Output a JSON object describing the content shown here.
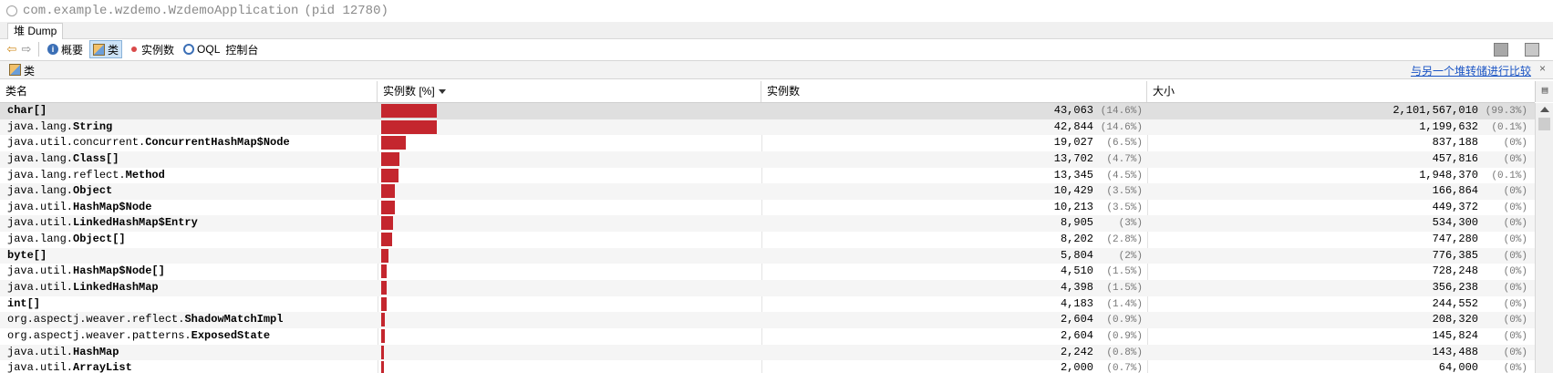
{
  "window": {
    "title": "com.example.wzdemo.WzdemoApplication",
    "pid": "(pid 12780)"
  },
  "tab": {
    "label": "堆 Dump"
  },
  "toolbar": {
    "summary": "概要",
    "classes": "类",
    "instances": "实例数",
    "oql": "OQL",
    "console": "控制台"
  },
  "panel": {
    "title": "类",
    "compare_link": "与另一个堆转储进行比较",
    "close": "×"
  },
  "table": {
    "headers": {
      "name": "类名",
      "instances_pct": "实例数 [%]",
      "instances": "实例数",
      "size": "大小"
    },
    "sort": {
      "column": "instances_pct",
      "direction": "descending"
    },
    "rows": [
      {
        "pkg": "",
        "cls": "char[]",
        "bar_pct": 14.6,
        "count": "43,063",
        "count_pct": "(14.6%)",
        "size": "2,101,567,010",
        "size_pct": "(99.3%)"
      },
      {
        "pkg": "java.lang.",
        "cls": "String",
        "bar_pct": 14.6,
        "count": "42,844",
        "count_pct": "(14.6%)",
        "size": "1,199,632",
        "size_pct": "(0.1%)"
      },
      {
        "pkg": "java.util.concurrent.",
        "cls": "ConcurrentHashMap$Node",
        "bar_pct": 6.5,
        "count": "19,027",
        "count_pct": "(6.5%)",
        "size": "837,188",
        "size_pct": "(0%)"
      },
      {
        "pkg": "java.lang.",
        "cls": "Class[]",
        "bar_pct": 4.7,
        "count": "13,702",
        "count_pct": "(4.7%)",
        "size": "457,816",
        "size_pct": "(0%)"
      },
      {
        "pkg": "java.lang.reflect.",
        "cls": "Method",
        "bar_pct": 4.5,
        "count": "13,345",
        "count_pct": "(4.5%)",
        "size": "1,948,370",
        "size_pct": "(0.1%)"
      },
      {
        "pkg": "java.lang.",
        "cls": "Object",
        "bar_pct": 3.5,
        "count": "10,429",
        "count_pct": "(3.5%)",
        "size": "166,864",
        "size_pct": "(0%)"
      },
      {
        "pkg": "java.util.",
        "cls": "HashMap$Node",
        "bar_pct": 3.5,
        "count": "10,213",
        "count_pct": "(3.5%)",
        "size": "449,372",
        "size_pct": "(0%)"
      },
      {
        "pkg": "java.util.",
        "cls": "LinkedHashMap$Entry",
        "bar_pct": 3.0,
        "count": "8,905",
        "count_pct": "(3%)",
        "size": "534,300",
        "size_pct": "(0%)"
      },
      {
        "pkg": "java.lang.",
        "cls": "Object[]",
        "bar_pct": 2.8,
        "count": "8,202",
        "count_pct": "(2.8%)",
        "size": "747,280",
        "size_pct": "(0%)"
      },
      {
        "pkg": "",
        "cls": "byte[]",
        "bar_pct": 2.0,
        "count": "5,804",
        "count_pct": "(2%)",
        "size": "776,385",
        "size_pct": "(0%)"
      },
      {
        "pkg": "java.util.",
        "cls": "HashMap$Node[]",
        "bar_pct": 1.5,
        "count": "4,510",
        "count_pct": "(1.5%)",
        "size": "728,248",
        "size_pct": "(0%)"
      },
      {
        "pkg": "java.util.",
        "cls": "LinkedHashMap",
        "bar_pct": 1.5,
        "count": "4,398",
        "count_pct": "(1.5%)",
        "size": "356,238",
        "size_pct": "(0%)"
      },
      {
        "pkg": "",
        "cls": "int[]",
        "bar_pct": 1.4,
        "count": "4,183",
        "count_pct": "(1.4%)",
        "size": "244,552",
        "size_pct": "(0%)"
      },
      {
        "pkg": "org.aspectj.weaver.reflect.",
        "cls": "ShadowMatchImpl",
        "bar_pct": 0.9,
        "count": "2,604",
        "count_pct": "(0.9%)",
        "size": "208,320",
        "size_pct": "(0%)"
      },
      {
        "pkg": "org.aspectj.weaver.patterns.",
        "cls": "ExposedState",
        "bar_pct": 0.9,
        "count": "2,604",
        "count_pct": "(0.9%)",
        "size": "145,824",
        "size_pct": "(0%)"
      },
      {
        "pkg": "java.util.",
        "cls": "HashMap",
        "bar_pct": 0.8,
        "count": "2,242",
        "count_pct": "(0.8%)",
        "size": "143,488",
        "size_pct": "(0%)"
      },
      {
        "pkg": "java.util.",
        "cls": "ArrayList",
        "bar_pct": 0.7,
        "count": "2,000",
        "count_pct": "(0.7%)",
        "size": "64,000",
        "size_pct": "(0%)"
      }
    ]
  },
  "colors": {
    "bar": "#c4262e",
    "link": "#1a54c4",
    "selected_row": "#dfdfdf"
  }
}
